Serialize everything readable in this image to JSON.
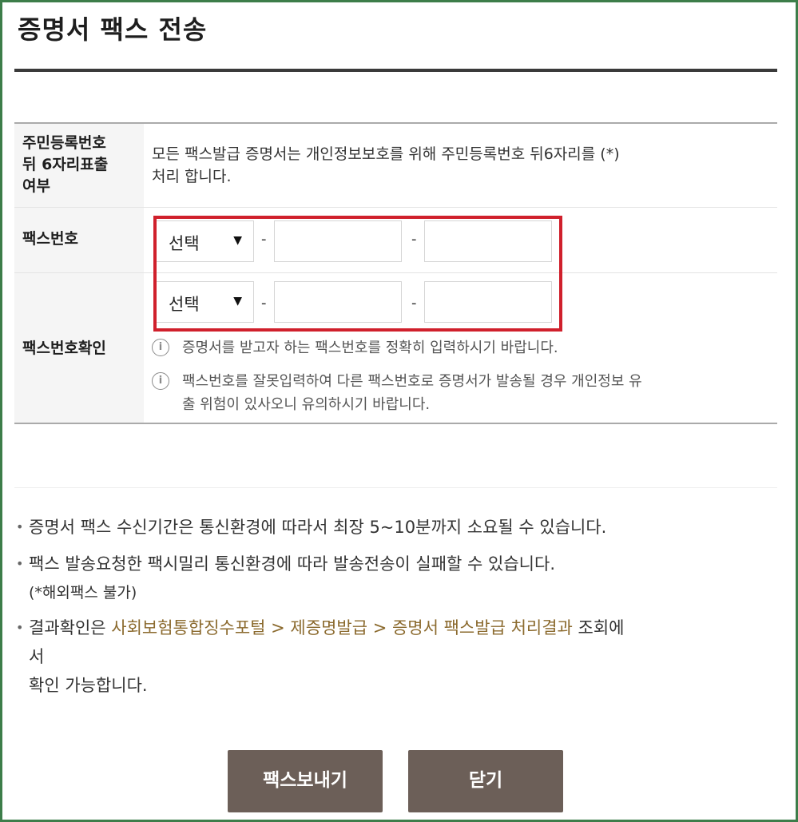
{
  "title": "증명서 팩스 전송",
  "table": {
    "row1": {
      "label_lines": [
        "주민등록번호",
        "뒤 6자리표출",
        "여부"
      ],
      "text_lines": [
        "모든 팩스발급 증명서는 개인정보보호를 위해 주민등록번호 뒤6자리를 (*)",
        "처리 합니다."
      ]
    },
    "fax_number": {
      "label": "팩스번호",
      "select_value": "선택",
      "dash": "-",
      "arrow": "▼"
    },
    "fax_confirm": {
      "label": "팩스번호확인",
      "select_value": "선택",
      "dash": "-",
      "arrow": "▼"
    },
    "notices": [
      {
        "icon": "info-icon",
        "lines": [
          "증명서를 받고자 하는 팩스번호를 정확히 입력하시기 바랍니다."
        ]
      },
      {
        "icon": "info-icon",
        "lines": [
          "팩스번호를 잘못입력하여 다른 팩스번호로 증명서가 발송될 경우 개인정보 유",
          "출 위험이 있사오니 유의하시기 바랍니다."
        ]
      }
    ],
    "info_glyph": "i"
  },
  "bullets": {
    "dot": "•",
    "item1": "증명서 팩스 수신기간은 통신환경에 따라서 최장 5~10분까지 소요될 수 있습니다.",
    "item2_line1": "팩스 발송요청한 팩시밀리 통신환경에 따라 발송전송이 실패할 수 있습니다.",
    "item2_line2": "(*해외팩스 불가)",
    "item3_prefix": "결과확인은 ",
    "item3_path": "사회보험통합징수포털 > 제증명발급 > 증명서 팩스발급 처리결과",
    "item3_suffix_line1": " 조회에",
    "item3_line2": "서",
    "item3_line3": "확인 가능합니다."
  },
  "buttons": {
    "send": "팩스보내기",
    "close": "닫기"
  },
  "colors": {
    "frame": "#3d7d4a",
    "highlight": "#d0202c",
    "button": "#6c5f58",
    "path_link": "#8b6a2e"
  }
}
